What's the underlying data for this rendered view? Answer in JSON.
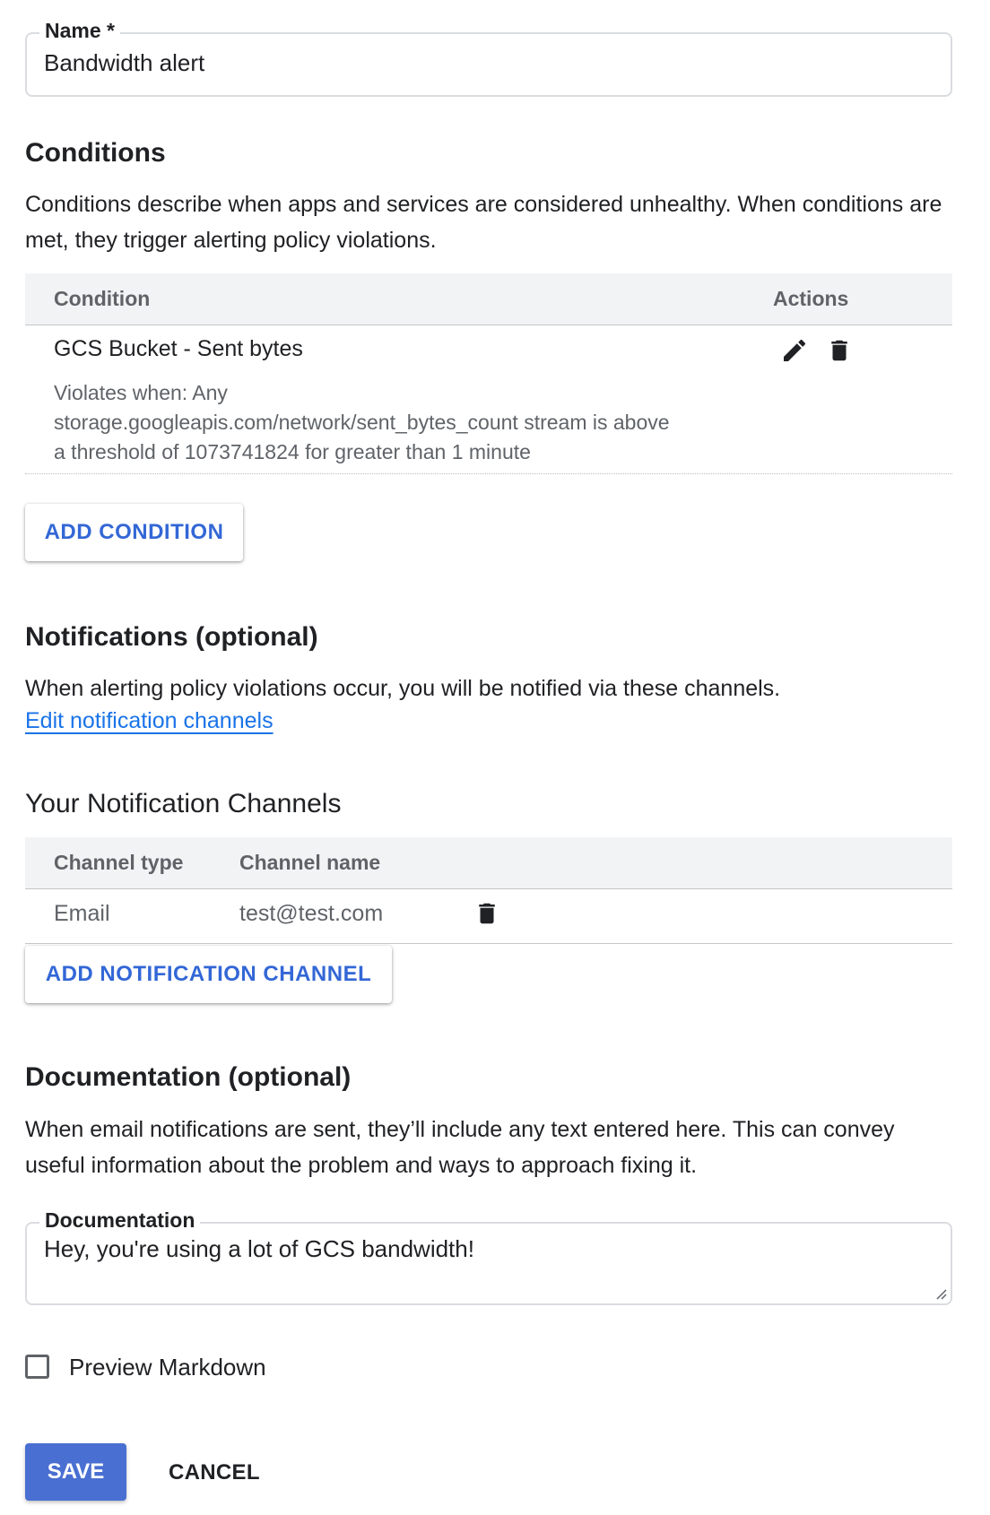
{
  "name_field": {
    "label": "Name *",
    "value": "Bandwidth alert"
  },
  "conditions": {
    "heading": "Conditions",
    "description": "Conditions describe when apps and services are considered unhealthy. When conditions are met, they trigger alerting policy violations.",
    "table": {
      "col_condition": "Condition",
      "col_actions": "Actions",
      "rows": [
        {
          "title": "GCS Bucket - Sent bytes",
          "detail_line1": "Violates when: Any",
          "detail_line2": "storage.googleapis.com/network/sent_bytes_count stream is above",
          "detail_line3": "a threshold of 1073741824 for greater than 1 minute"
        }
      ]
    },
    "add_button": "ADD CONDITION"
  },
  "notifications": {
    "heading": "Notifications (optional)",
    "description": "When alerting policy violations occur, you will be notified via these channels.",
    "edit_link": "Edit notification channels",
    "channels_heading": "Your Notification Channels",
    "table": {
      "col_type": "Channel type",
      "col_name": "Channel name",
      "rows": [
        {
          "type": "Email",
          "name": "test@test.com"
        }
      ]
    },
    "add_button": "ADD NOTIFICATION CHANNEL"
  },
  "documentation": {
    "heading": "Documentation (optional)",
    "description": "When email notifications are sent, they’ll include any text entered here. This can convey useful information about the problem and ways to approach fixing it.",
    "field_label": "Documentation",
    "field_value": "Hey, you're using a lot of GCS bandwidth!"
  },
  "preview_markdown": {
    "label": "Preview Markdown",
    "checked": false
  },
  "actions": {
    "save": "SAVE",
    "cancel": "CANCEL"
  },
  "colors": {
    "accent": "#3367d6",
    "link": "#1a73e8",
    "save_bg": "#4a6fd2",
    "header_bg": "#f1f3f4"
  }
}
